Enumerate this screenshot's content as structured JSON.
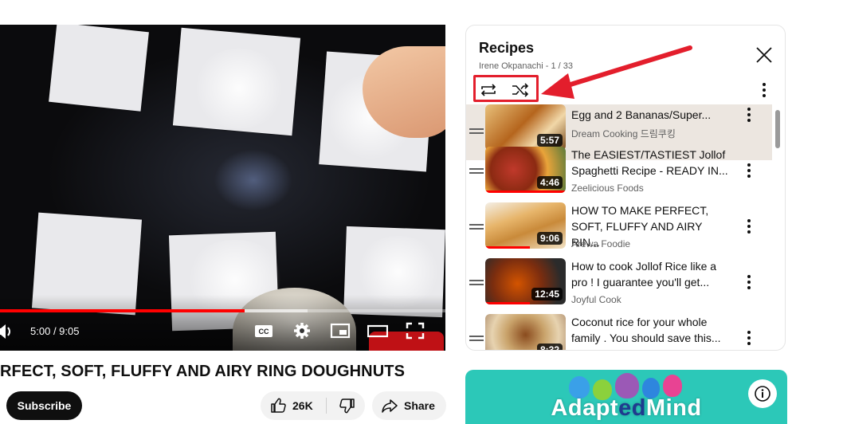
{
  "player": {
    "current_time": "5:00",
    "duration": "9:05",
    "progress_played": 0.55,
    "progress_buffered": 0.69
  },
  "video": {
    "title": "RFECT, SOFT, FLUFFY AND AIRY RING DOUGHNUTS",
    "subscribe_label": "Subscribe",
    "like_count": "26K",
    "share_label": "Share"
  },
  "playlist": {
    "title": "Recipes",
    "meta": "Irene Okpanachi - 1 / 33",
    "items": [
      {
        "title": "Egg and 2 Bananas/Super...",
        "channel": "Dream Cooking 드림쿠킹",
        "duration": "5:57",
        "active": true,
        "watched": 0.1
      },
      {
        "title": "The EASIEST/TASTIEST Jollof Spaghetti Recipe - READY IN...",
        "channel": "Zeelicious Foods",
        "duration": "4:46",
        "active": false,
        "watched": 1.0
      },
      {
        "title": "HOW TO MAKE PERFECT, SOFT, FLUFFY AND AIRY RIN...",
        "channel": "Arewa Foodie",
        "duration": "9:06",
        "active": false,
        "watched": 0.55
      },
      {
        "title": "How to cook Jollof Rice like a pro ! I guarantee you'll get...",
        "channel": "Joyful Cook",
        "duration": "12:45",
        "active": false,
        "watched": 0.55
      },
      {
        "title": "Coconut rice for your whole family . You should save this...",
        "channel": "",
        "duration": "8:32",
        "active": false,
        "watched": 0.0
      }
    ]
  },
  "ad": {
    "brand_prefix": "Adapt",
    "brand_middle": "ed",
    "brand_suffix": "Mind"
  },
  "colors": {
    "accent_red": "#ff0000",
    "annotation_red": "#e31e2c",
    "ad_teal": "#2cc8b8"
  },
  "icons": [
    "volume-icon",
    "closed-captions-icon",
    "settings-icon",
    "miniplayer-icon",
    "theater-icon",
    "fullscreen-icon",
    "like-icon",
    "dislike-icon",
    "share-icon",
    "close-icon",
    "loop-icon",
    "shuffle-icon",
    "more-vert-icon",
    "info-icon"
  ]
}
